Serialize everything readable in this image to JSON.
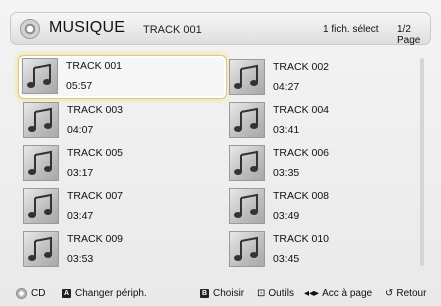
{
  "header": {
    "title": "MUSIQUE",
    "subtitle": "TRACK 001",
    "selection_count": "1 fich. sélect",
    "page_indicator": "1/2 Page"
  },
  "tracks": [
    {
      "name": "TRACK 001",
      "duration": "05:57",
      "selected": true
    },
    {
      "name": "TRACK 002",
      "duration": "04:27"
    },
    {
      "name": "TRACK 003",
      "duration": "04:07"
    },
    {
      "name": "TRACK 004",
      "duration": "03:41"
    },
    {
      "name": "TRACK 005",
      "duration": "03:17"
    },
    {
      "name": "TRACK 006",
      "duration": "03:35"
    },
    {
      "name": "TRACK 007",
      "duration": "03:47"
    },
    {
      "name": "TRACK 008",
      "duration": "03:49"
    },
    {
      "name": "TRACK 009",
      "duration": "03:53"
    },
    {
      "name": "TRACK 010",
      "duration": "03:45"
    }
  ],
  "footer": {
    "cd": "CD",
    "key_a": "A",
    "change_device": "Changer périph.",
    "key_b": "B",
    "choose": "Choisir",
    "tools": "Outils",
    "page_access": "Acc à page",
    "back": "Retour"
  },
  "colors": {
    "selection_glow": "#f5dc78",
    "background": "#efefef"
  },
  "icons": {
    "header": "disc-icon",
    "tile": "music-note-icon",
    "footer_cd": "dpad-icon",
    "tools": "tools-icon",
    "page": "skip-arrows-icon",
    "back": "return-icon"
  }
}
